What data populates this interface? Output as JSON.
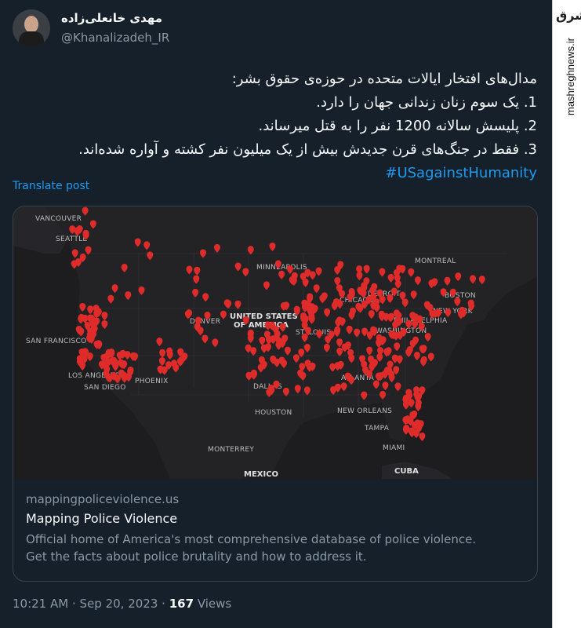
{
  "author": {
    "display_name": "مهدی خانعلی‌زاده",
    "handle": "@Khanalizadeh_IR"
  },
  "tweet": {
    "lines": [
      "مدال‌های افتخار ایالات متحده در حوزه‌ی حقوق بشر:",
      "1. یک سوم زنان زندانی جهان را دارد.",
      "2. پلیسش سالانه 1200 نفر را به قتل میرساند.",
      "3. فقط در جنگ‌های قرن جدیدش بیش از یک میلیون نفر کشته و آواره شده‌اند."
    ],
    "hashtag": "#USagainstHumanity",
    "translate_label": "Translate post"
  },
  "map": {
    "labels": {
      "vancouver": "VANCOUVER",
      "seattle": "SEATTLE",
      "minneapolis": "MINNEAPOLIS",
      "montreal": "MONTREAL",
      "boston": "BOSTON",
      "detroit": "DETROIT",
      "chicago": "CHICAGO",
      "new_york": "NEW YORK",
      "philadelphia": "PHILADELPHIA",
      "washington": "WASHINGTON",
      "denver": "DENVER",
      "united_states_1": "UNITED STATES",
      "united_states_2": "OF AMERICA",
      "st_louis": "ST. LOUIS",
      "san_francisco": "SAN FRANCISCO",
      "los_angeles": "LOS ANGELES",
      "san_diego": "SAN DIEGO",
      "phoenix": "PHOENIX",
      "dallas": "DALLAS",
      "atlanta": "ATLANTA",
      "houston": "HOUSTON",
      "new_orleans": "NEW ORLEANS",
      "tampa": "TAMPA",
      "miami": "MIAMI",
      "monterrey": "MONTERREY",
      "mexico": "MEXICO",
      "cuba": "CUBA"
    },
    "marker_color": "#e02b2b",
    "background_color": "#1d1d1f"
  },
  "card": {
    "domain": "mappingpoliceviolence.us",
    "title": "Mapping Police Violence",
    "description_line1": "Official home of America's most comprehensive database of police violence.",
    "description_line2": "Get the facts about police brutality and how to address it."
  },
  "meta": {
    "time": "10:21 AM",
    "separator": "·",
    "date": "Sep 20, 2023",
    "views_count": "167",
    "views_label": "Views"
  },
  "watermark": {
    "logo_text": "مشرق",
    "site": "mashreghnews.ir"
  }
}
